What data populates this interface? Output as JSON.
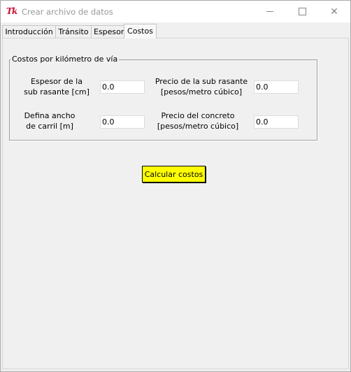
{
  "window": {
    "title": "Crear archivo de datos",
    "icon_text": "Tk",
    "controls": {
      "minimize": "minimize-icon",
      "maximize": "maximize-icon",
      "close": "close-icon"
    }
  },
  "tabs": [
    {
      "label": "Introducción",
      "active": false
    },
    {
      "label": "Tránsito",
      "active": false
    },
    {
      "label": "Espesor",
      "active": false
    },
    {
      "label": "Costos",
      "active": true
    }
  ],
  "costs": {
    "group_title": "Costos por kilómetro de vía",
    "espesor": {
      "label_line1": "Espesor de la",
      "label_line2": "sub rasante [cm]",
      "value": "0.0"
    },
    "precio_subrasante": {
      "label_line1": "Precio de la sub rasante",
      "label_line2": "[pesos/metro cúbico]",
      "value": "0.0"
    },
    "ancho_carril": {
      "label_line1": "Defina ancho",
      "label_line2": "de carril [m]",
      "value": "0.0"
    },
    "precio_concreto": {
      "label_line1": "Precio del concreto",
      "label_line2": "[pesos/metro cúbico]",
      "value": "0.0"
    },
    "calc_button": "Calcular costos",
    "calc_button_color": "#ffff00"
  }
}
